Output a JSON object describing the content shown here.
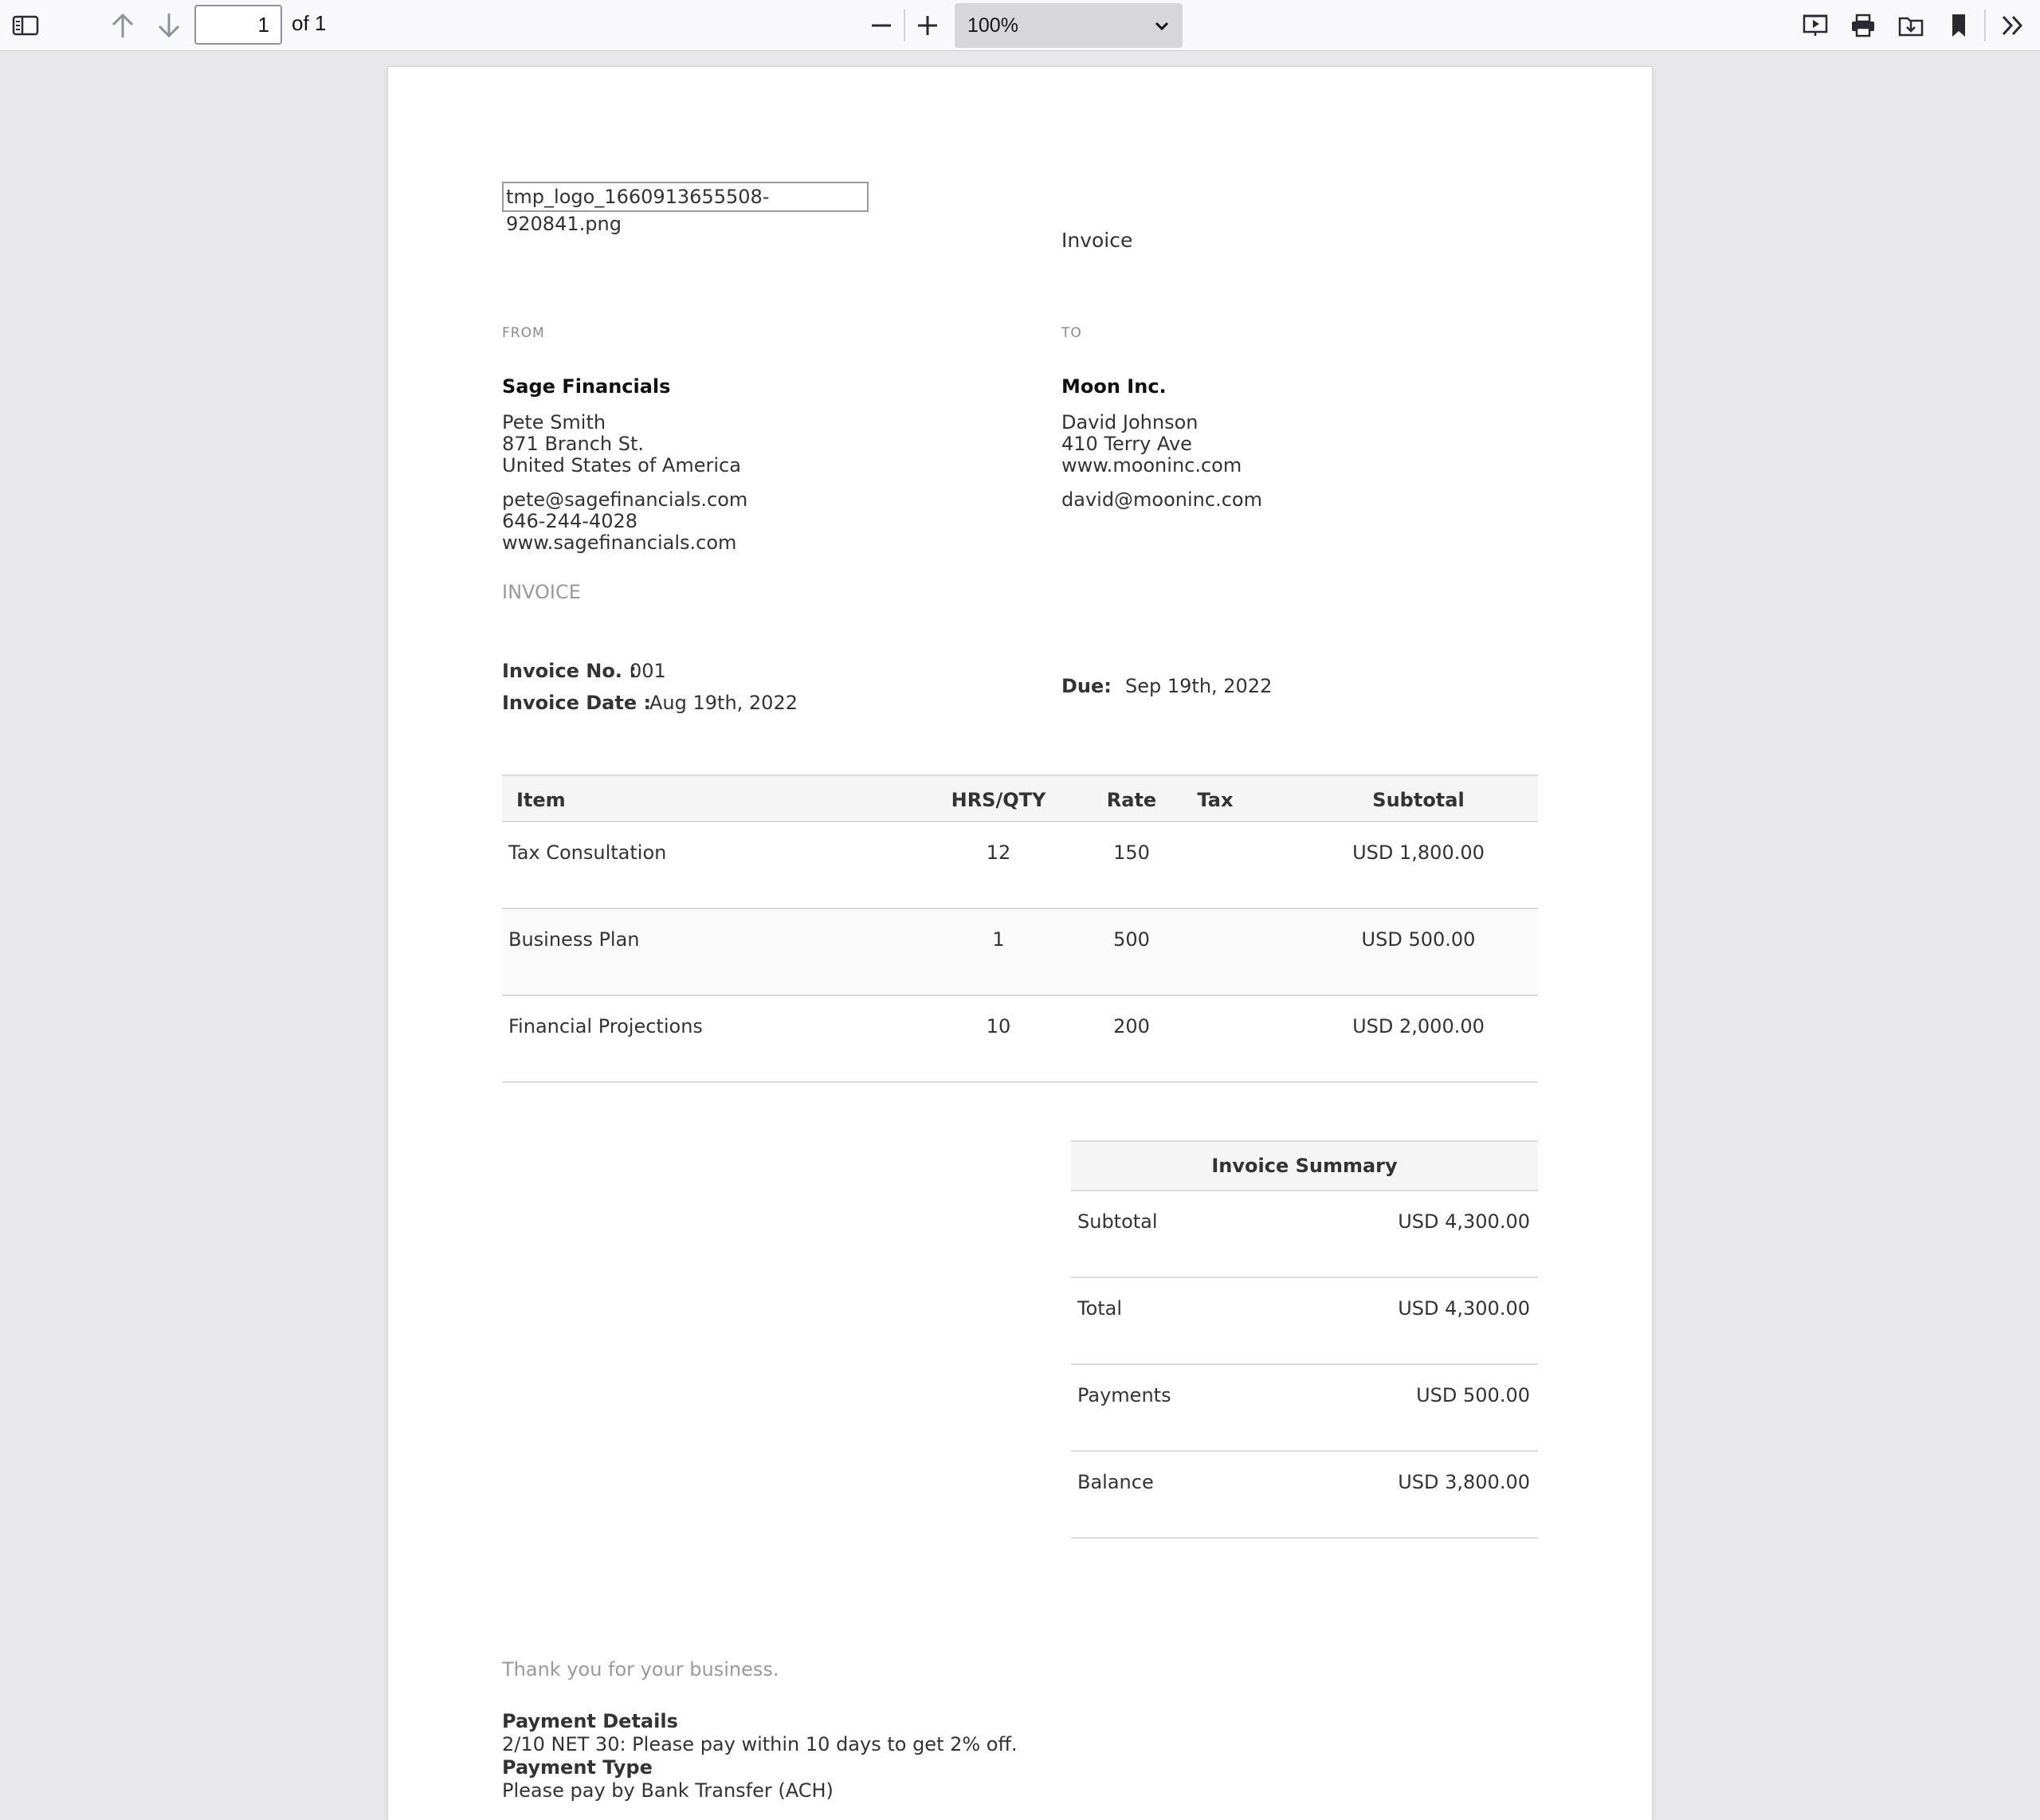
{
  "toolbar": {
    "page_current": "1",
    "page_count": "of 1",
    "zoom": "100%",
    "icons": [
      "sidebar-toggle-icon",
      "arrow-up-icon",
      "arrow-down-icon",
      "zoom-out-icon",
      "zoom-in-icon",
      "chevron-down-icon",
      "presentation-icon",
      "print-icon",
      "save-icon",
      "bookmark-icon",
      "double-chevron-right-icon"
    ]
  },
  "invoice": {
    "logo_text": "tmp_logo_1660913655508-920841.png",
    "heading": "Invoice",
    "from": {
      "label": "FROM",
      "company": "Sage Financials",
      "contact": "Pete Smith",
      "address1": "871 Branch St.",
      "address2": "United States of America",
      "email": "pete@sagefinancials.com",
      "phone": "646-244-4028",
      "website": "www.sagefinancials.com"
    },
    "to": {
      "label": "TO",
      "company": "Moon Inc.",
      "contact": "David Johnson",
      "address1": "410 Terry Ave",
      "website": "www.mooninc.com",
      "email": "david@mooninc.com"
    },
    "doc_label": "INVOICE",
    "meta": {
      "number_label": "Invoice No. :",
      "number": "001",
      "date_label": "Invoice Date :",
      "date": "Aug 19th, 2022",
      "due_label": "Due:",
      "due": "Sep 19th, 2022"
    },
    "table": {
      "headers": {
        "item": "Item",
        "qty": "HRS/QTY",
        "rate": "Rate",
        "tax": "Tax",
        "subtotal": "Subtotal"
      },
      "rows": [
        {
          "item": "Tax Consultation",
          "qty": "12",
          "rate": "150",
          "tax": "",
          "subtotal": "USD 1,800.00"
        },
        {
          "item": "Business Plan",
          "qty": "1",
          "rate": "500",
          "tax": "",
          "subtotal": "USD 500.00"
        },
        {
          "item": "Financial Projections",
          "qty": "10",
          "rate": "200",
          "tax": "",
          "subtotal": "USD 2,000.00"
        }
      ]
    },
    "summary": {
      "title": "Invoice Summary",
      "rows": [
        {
          "label": "Subtotal",
          "value": "USD 4,300.00"
        },
        {
          "label": "Total",
          "value": "USD 4,300.00"
        },
        {
          "label": "Payments",
          "value": "USD 500.00"
        },
        {
          "label": "Balance",
          "value": "USD 3,800.00"
        }
      ]
    },
    "footer": {
      "thanks": "Thank you for your business.",
      "payment_details_label": "Payment Details",
      "payment_details": "2/10 NET 30: Please pay within 10 days to get 2% off.",
      "payment_type_label": "Payment Type",
      "payment_type": "Please pay by Bank Transfer (ACH)"
    }
  }
}
